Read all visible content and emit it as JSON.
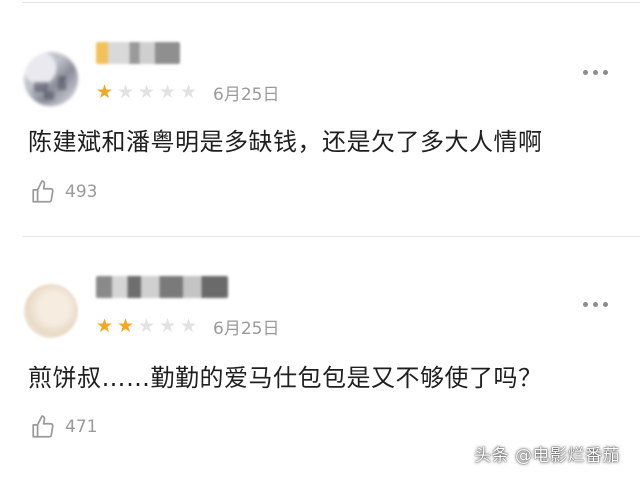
{
  "comments": [
    {
      "rating_filled": 1,
      "rating_total": 5,
      "date": "6月25日",
      "text": "陈建斌和潘粤明是多缺钱，还是欠了多大人情啊",
      "likes": "493"
    },
    {
      "rating_filled": 2,
      "rating_total": 5,
      "date": "6月25日",
      "text": "煎饼叔……勤勤的爱马仕包包是又不够使了吗？",
      "likes": "471"
    }
  ],
  "icons": {
    "more": "more-dots-icon",
    "like": "thumbs-up-icon",
    "star": "star-icon"
  },
  "colors": {
    "star_on": "#f5a623",
    "star_off": "#e2e2e2",
    "meta_text": "#9a9a9a"
  },
  "watermark": "头条 @电影烂番茄"
}
